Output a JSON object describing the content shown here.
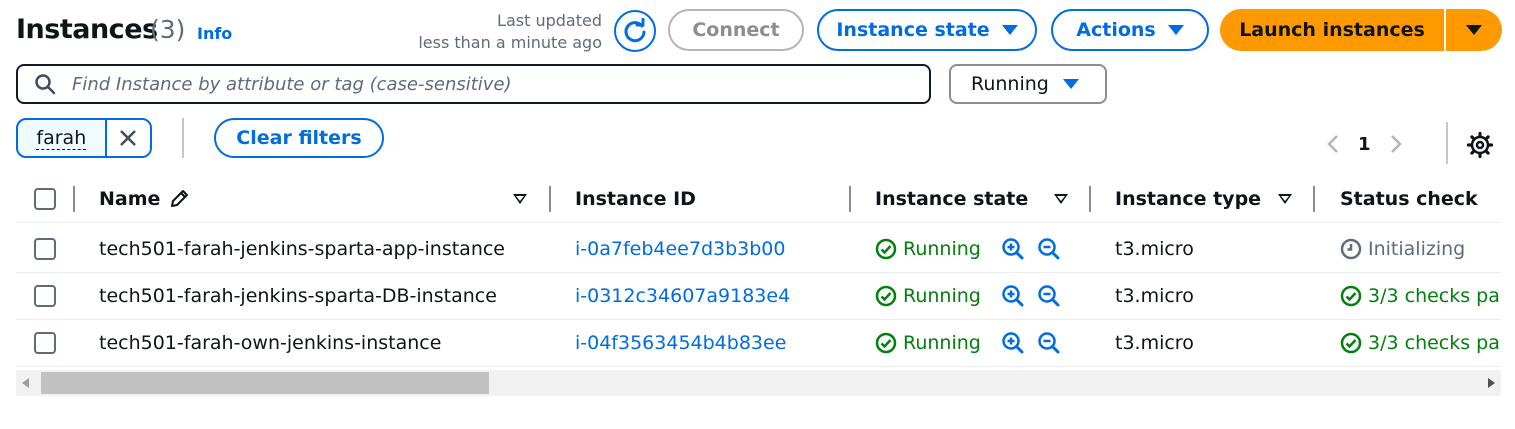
{
  "header": {
    "title": "Instances",
    "count": "(3)",
    "info": "Info",
    "last_updated_line1": "Last updated",
    "last_updated_line2": "less than a minute ago",
    "connect_label": "Connect",
    "instance_state_label": "Instance state",
    "actions_label": "Actions",
    "launch_label": "Launch instances"
  },
  "filter": {
    "search_placeholder": "Find Instance by attribute or tag (case-sensitive)",
    "state_select_value": "Running",
    "token_label": "farah",
    "clear_filters_label": "Clear filters"
  },
  "pagination": {
    "current_page": "1"
  },
  "table": {
    "columns": {
      "name": "Name",
      "instance_id": "Instance ID",
      "instance_state": "Instance state",
      "instance_type": "Instance type",
      "status_check": "Status check"
    },
    "rows": [
      {
        "name": "tech501-farah-jenkins-sparta-app-instance",
        "instance_id": "i-0a7feb4ee7d3b3b00",
        "state": "Running",
        "type": "t3.micro",
        "status": "Initializing"
      },
      {
        "name": "tech501-farah-jenkins-sparta-DB-instance",
        "instance_id": "i-0312c34607a9183e4",
        "state": "Running",
        "type": "t3.micro",
        "status": "3/3 checks pa"
      },
      {
        "name": "tech501-farah-own-jenkins-instance",
        "instance_id": "i-04f3563454b4b83ee",
        "state": "Running",
        "type": "t3.micro",
        "status": "3/3 checks pa"
      }
    ]
  },
  "colors": {
    "link_blue": "#006ce0",
    "launch_orange": "#ff9900",
    "success_green": "#037f0c",
    "muted_grey": "#5f6b7a"
  },
  "icons": [
    "refresh-icon",
    "caret-down-icon",
    "search-icon",
    "close-icon",
    "chevron-left-icon",
    "chevron-right-icon",
    "gear-icon",
    "edit-icon",
    "check-circle-icon",
    "zoom-in-icon",
    "zoom-out-icon",
    "clock-icon"
  ]
}
